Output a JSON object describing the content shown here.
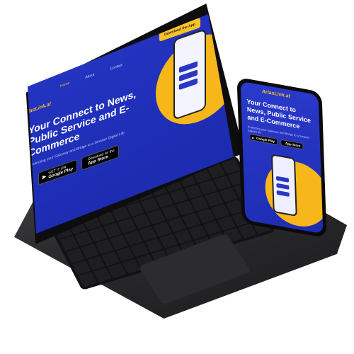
{
  "site": {
    "logo": "ArlasLink.al",
    "nav": [
      "Home",
      "About",
      "Contact"
    ],
    "download_label": "Download the App",
    "hero_title": "Your Connect to News, Public Service and E-Commerce",
    "hero_subtitle": "Protecting your Gateway and Bridge to a Smarter Digital Life",
    "stores": {
      "google_small": "GET IT ON",
      "google_big": "Google Play",
      "apple_small": "Download on the",
      "apple_big": "App Store"
    }
  },
  "phone": {
    "logo": "ArlasLink.al",
    "hero_title": "Your Connect to News, Public Service and E-Commerce",
    "hero_subtitle": "Protecting your Gateway and Bridge to a Smarter Digital Life"
  },
  "colors": {
    "brand_blue": "#2738c9",
    "accent_yellow": "#f7c325",
    "device_dark": "#1c1c1e"
  }
}
